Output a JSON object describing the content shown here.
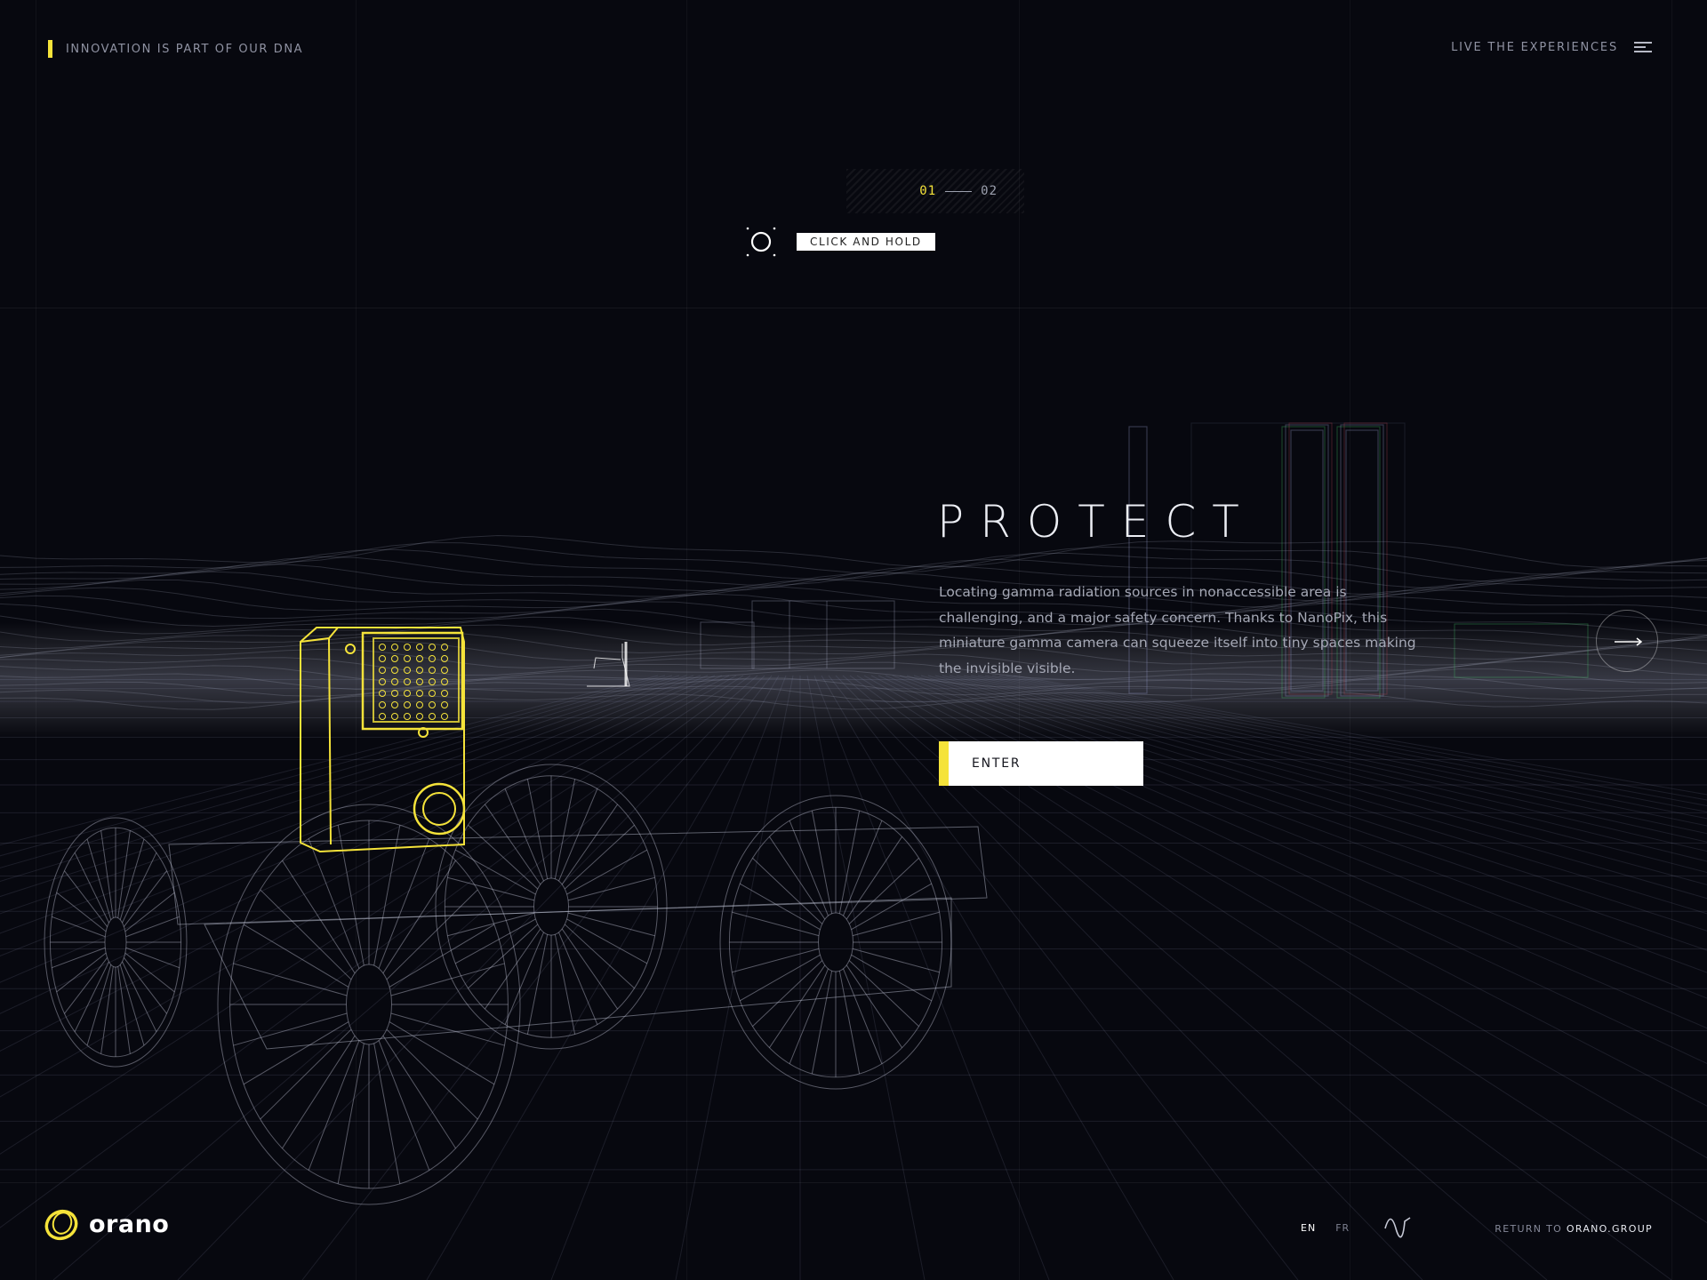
{
  "header": {
    "tagline": "INNOVATION IS PART OF OUR DNA",
    "experiences_link": "LIVE THE EXPERIENCES",
    "menu_icon": "hamburger-menu-icon"
  },
  "pager": {
    "current": "01",
    "total": "02"
  },
  "interaction": {
    "hint": "CLICK AND HOLD",
    "icon": "hold-circle-icon"
  },
  "main": {
    "title": "PROTECT",
    "description": "Locating gamma radiation sources in nonaccessible area is challenging, and a major safety concern. Thanks to NanoPix, this miniature gamma camera can squeeze itself into tiny spaces making the invisible visible.",
    "enter_label": "ENTER",
    "next_icon": "arrow-right-icon"
  },
  "footer": {
    "logo_text": "orano",
    "lang_active": "EN",
    "lang_other": "FR",
    "sound_icon": "sound-wave-icon",
    "return_prefix": "RETURN TO",
    "return_site": "ORANO.GROUP"
  },
  "colors": {
    "background": "#07080f",
    "accent": "#f5e33a",
    "text_primary": "#eceef4",
    "text_muted": "#8f92a2"
  }
}
